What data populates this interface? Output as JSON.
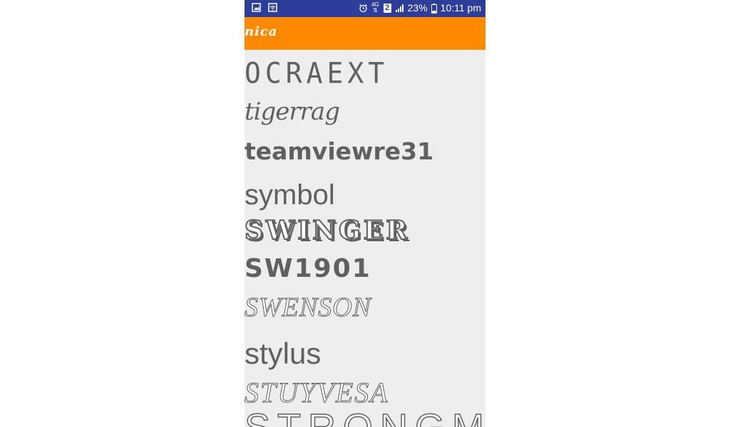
{
  "status_bar": {
    "network": "4G",
    "sim": "2",
    "battery": "23%",
    "time": "10:11 pm",
    "bg_color": "#2c3e9a"
  },
  "toolbar": {
    "title": "nica",
    "bg_color": "#ff8a00"
  },
  "fonts": [
    {
      "label": "OCRAEXT"
    },
    {
      "label": "tigerrag"
    },
    {
      "label": "teamviewre31"
    },
    {
      "label": "symbol"
    },
    {
      "label": "SWINGER"
    },
    {
      "label": "SW1901"
    },
    {
      "label": "SWENSON"
    },
    {
      "label": "stylus"
    },
    {
      "label": "STUYVESA"
    },
    {
      "label": "STRONGM"
    }
  ]
}
